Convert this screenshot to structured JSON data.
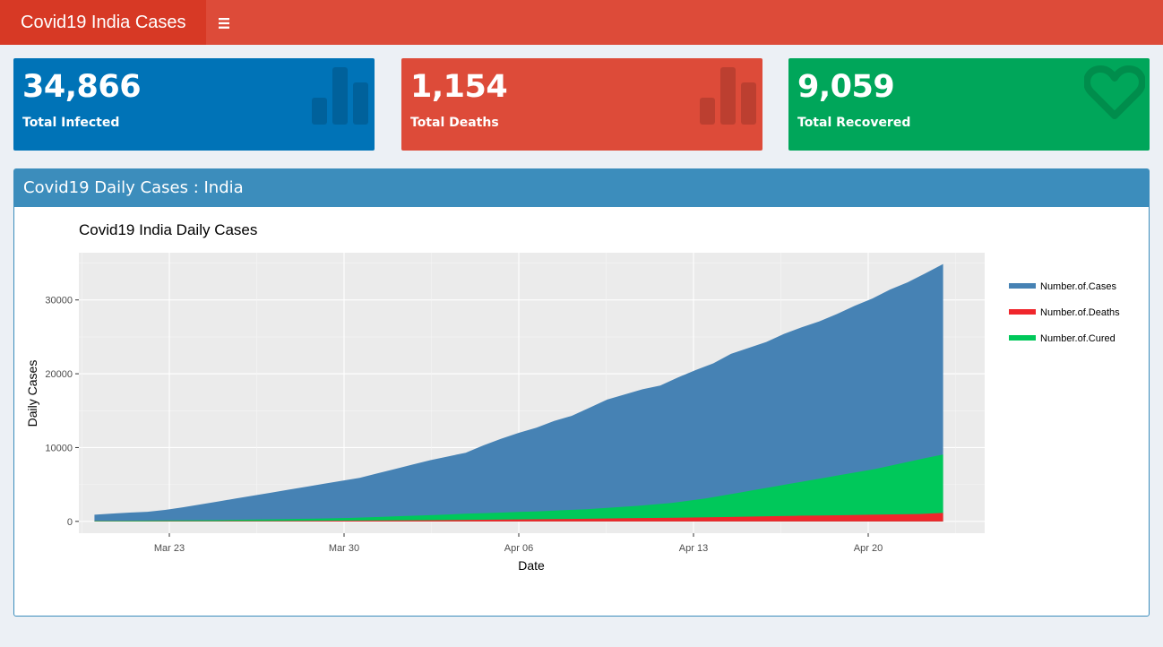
{
  "header": {
    "title": "Covid19 India Cases",
    "menu_icon": "hamburger-icon"
  },
  "value_boxes": [
    {
      "value": "34,866",
      "label": "Total Infected",
      "icon": "bar-chart-icon",
      "color": "#0073b7"
    },
    {
      "value": "1,154",
      "label": "Total Deaths",
      "icon": "bar-chart-icon",
      "color": "#dd4b39"
    },
    {
      "value": "9,059",
      "label": "Total Recovered",
      "icon": "heart-icon",
      "color": "#00a65a"
    }
  ],
  "panel": {
    "title": "Covid19 Daily Cases : India"
  },
  "chart_data": {
    "type": "area",
    "title": "Covid19 India Daily Cases",
    "xlabel": "Date",
    "ylabel": "Daily Cases",
    "x_ticks": [
      "Mar 23",
      "Mar 30",
      "Apr 06",
      "Apr 13",
      "Apr 20"
    ],
    "y_ticks": [
      "0",
      "10000",
      "20000",
      "30000"
    ],
    "ylim": [
      -1600,
      36400
    ],
    "x": [
      "2020-03-20",
      "2020-03-21",
      "2020-03-22",
      "2020-03-23",
      "2020-03-24",
      "2020-03-25",
      "2020-03-26",
      "2020-03-27",
      "2020-03-28",
      "2020-03-29",
      "2020-03-30",
      "2020-03-31",
      "2020-04-01",
      "2020-04-02",
      "2020-04-03",
      "2020-04-04",
      "2020-04-05",
      "2020-04-06",
      "2020-04-07",
      "2020-04-08",
      "2020-04-09",
      "2020-04-10",
      "2020-04-11",
      "2020-04-12",
      "2020-04-13",
      "2020-04-14",
      "2020-04-15",
      "2020-04-16",
      "2020-04-17",
      "2020-04-18",
      "2020-04-19",
      "2020-04-20",
      "2020-04-21",
      "2020-04-22",
      "2020-04-23"
    ],
    "series": [
      {
        "name": "Number.of.Cases",
        "color": "#4682b4",
        "values": [
          900,
          1050,
          1200,
          1300,
          1550,
          1900,
          2300,
          2700,
          3100,
          3500,
          3900,
          4300,
          4700,
          5100,
          5500,
          5900,
          6500,
          7100,
          7700,
          8300,
          8800,
          9300,
          10300,
          11200,
          12000,
          12700,
          13600,
          14300,
          15400,
          16500,
          17200,
          17900,
          18400,
          19500,
          20500,
          21400,
          22700,
          23500,
          24300,
          25400,
          26300,
          27100,
          28100,
          29200,
          30200,
          31400,
          32400,
          33600,
          34866
        ]
      },
      {
        "name": "Number.of.Deaths",
        "color": "#f0262c",
        "values": [
          20,
          24,
          27,
          32,
          38,
          45,
          52,
          60,
          70,
          80,
          95,
          110,
          125,
          140,
          165,
          190,
          220,
          250,
          280,
          310,
          350,
          390,
          430,
          460,
          500,
          540,
          590,
          640,
          700,
          760,
          800,
          850,
          900,
          950,
          1000,
          1154
        ]
      },
      {
        "name": "Number.of.Cured",
        "color": "#00c85a",
        "values": [
          80,
          90,
          100,
          110,
          125,
          140,
          160,
          180,
          200,
          230,
          260,
          300,
          340,
          380,
          420,
          470,
          540,
          620,
          700,
          780,
          860,
          950,
          1050,
          1120,
          1200,
          1280,
          1350,
          1450,
          1550,
          1650,
          1800,
          1950,
          2100,
          2300,
          2500,
          2800,
          3100,
          3500,
          3900,
          4300,
          4700,
          5100,
          5500,
          5900,
          6300,
          6700,
          7100,
          7600,
          8100,
          8600,
          9059
        ]
      }
    ]
  }
}
